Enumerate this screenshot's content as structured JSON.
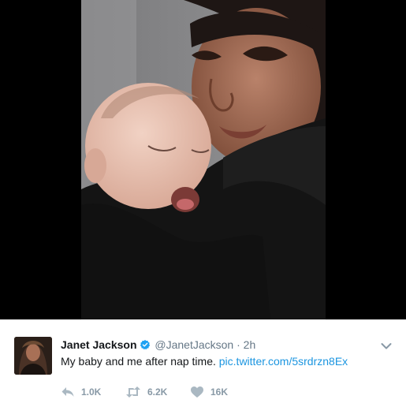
{
  "tweet": {
    "display_name": "Janet Jackson",
    "handle": "@JanetJackson",
    "separator": "·",
    "time": "2h",
    "text": "My baby and me after nap time.",
    "link": "pic.twitter.com/5srdrzn8Ex",
    "verified_color": "#1da1f2",
    "actions": {
      "reply_count": "1.0K",
      "retweet_count": "6.2K",
      "like_count": "16K"
    }
  },
  "icons": [
    "verified-badge-icon",
    "chevron-down-icon",
    "reply-icon",
    "retweet-icon",
    "heart-icon"
  ]
}
